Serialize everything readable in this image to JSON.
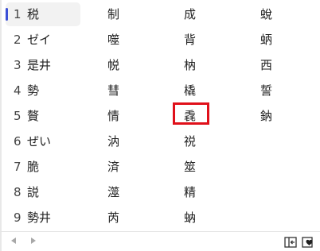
{
  "candidates": [
    [
      {
        "index": "1",
        "text": "税"
      },
      {
        "index": "",
        "text": "制"
      },
      {
        "index": "",
        "text": "成"
      },
      {
        "index": "",
        "text": "蛻"
      }
    ],
    [
      {
        "index": "2",
        "text": "ゼイ"
      },
      {
        "index": "",
        "text": "噬"
      },
      {
        "index": "",
        "text": "背"
      },
      {
        "index": "",
        "text": "蛃"
      }
    ],
    [
      {
        "index": "3",
        "text": "是井"
      },
      {
        "index": "",
        "text": "帨"
      },
      {
        "index": "",
        "text": "枘"
      },
      {
        "index": "",
        "text": "西"
      }
    ],
    [
      {
        "index": "4",
        "text": "勢"
      },
      {
        "index": "",
        "text": "彗"
      },
      {
        "index": "",
        "text": "橇"
      },
      {
        "index": "",
        "text": "誓"
      }
    ],
    [
      {
        "index": "5",
        "text": "贅"
      },
      {
        "index": "",
        "text": "情"
      },
      {
        "index": "",
        "text": "毳"
      },
      {
        "index": "",
        "text": "鈉"
      }
    ],
    [
      {
        "index": "6",
        "text": "ぜい"
      },
      {
        "index": "",
        "text": "汭"
      },
      {
        "index": "",
        "text": "祱"
      },
      {
        "index": "",
        "text": ""
      }
    ],
    [
      {
        "index": "7",
        "text": "脆"
      },
      {
        "index": "",
        "text": "済"
      },
      {
        "index": "",
        "text": "筮"
      },
      {
        "index": "",
        "text": ""
      }
    ],
    [
      {
        "index": "8",
        "text": "説"
      },
      {
        "index": "",
        "text": "澨"
      },
      {
        "index": "",
        "text": "精"
      },
      {
        "index": "",
        "text": ""
      }
    ],
    [
      {
        "index": "9",
        "text": "勢井"
      },
      {
        "index": "",
        "text": "芮"
      },
      {
        "index": "",
        "text": "蚋"
      },
      {
        "index": "",
        "text": ""
      }
    ]
  ],
  "selected_index": 0,
  "colors": {
    "accent": "#3b4fd6",
    "highlight_box": "#e0101a",
    "selected_bg": "#f2f2f2"
  },
  "icons": {
    "prev": "chevron-left-icon",
    "next": "chevron-right-icon",
    "collapse": "collapse-panel-icon",
    "favorite": "heart-icon"
  }
}
